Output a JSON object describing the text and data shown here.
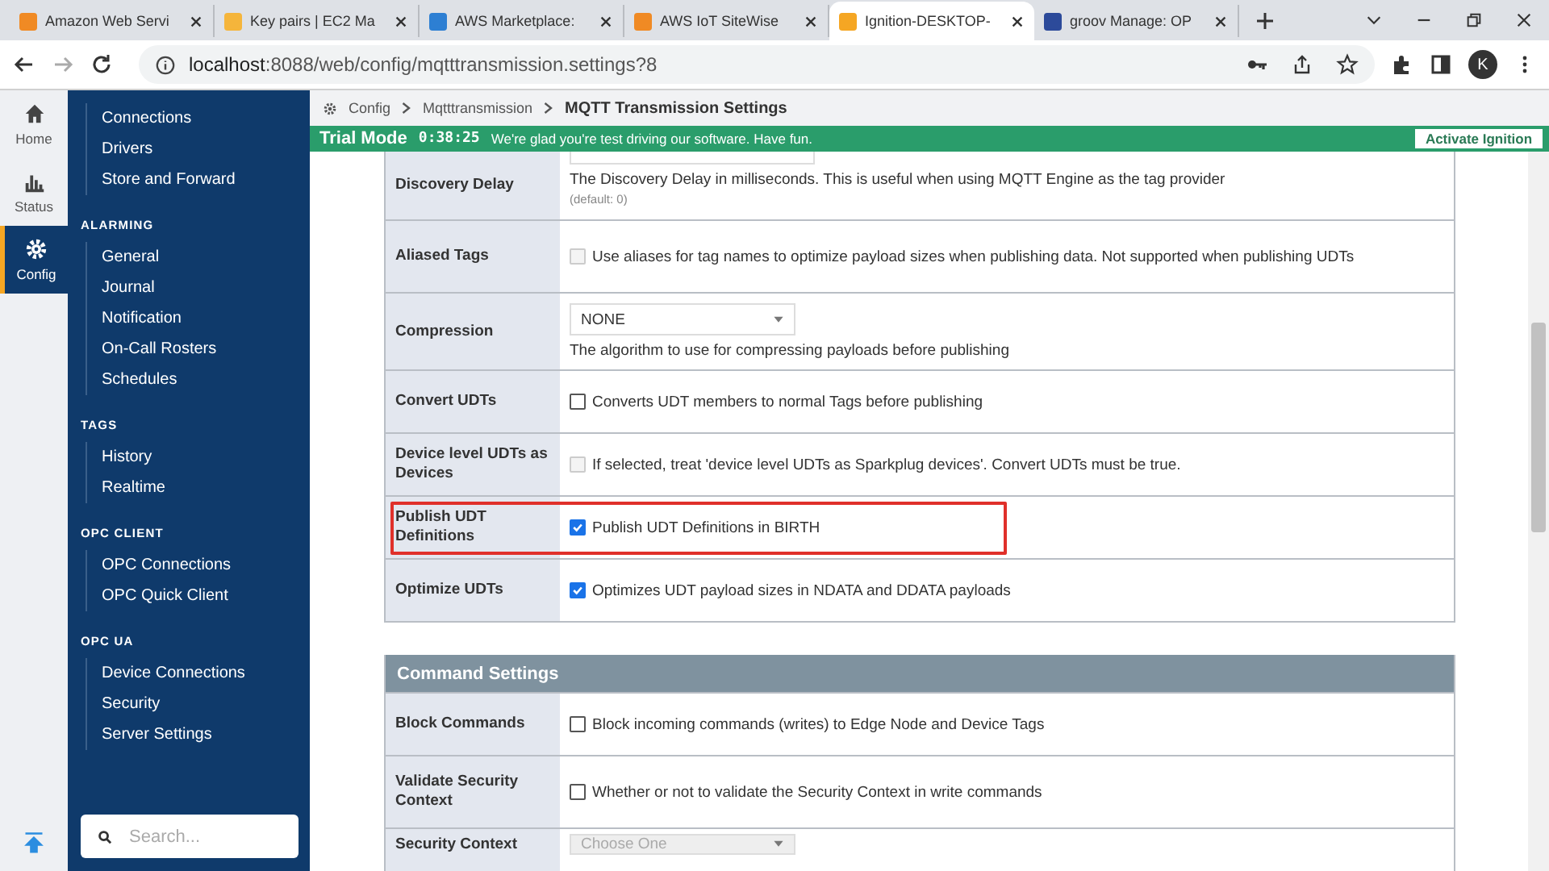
{
  "browser": {
    "tabs": [
      {
        "title": "Amazon Web Servi",
        "selected": false,
        "color": "#f08a24"
      },
      {
        "title": "Key pairs | EC2 Ma",
        "selected": false,
        "color": "#f5b53b"
      },
      {
        "title": "AWS Marketplace: ",
        "selected": false,
        "color": "#2d7fd3"
      },
      {
        "title": "AWS IoT SiteWise",
        "selected": false,
        "color": "#f08a24"
      },
      {
        "title": "Ignition-DESKTOP-",
        "selected": true,
        "color": "#f5a623"
      },
      {
        "title": "groov Manage: OP",
        "selected": false,
        "color": "#2c4a9a"
      }
    ],
    "url_host": "localhost",
    "url_rest": ":8088/web/config/mqtttransmission.settings?8",
    "profile": "K"
  },
  "rail": [
    {
      "label": "Home",
      "selected": false
    },
    {
      "label": "Status",
      "selected": false
    },
    {
      "label": "Config",
      "selected": true
    }
  ],
  "nav": [
    {
      "items": [
        "Connections",
        "Drivers",
        "Store and Forward"
      ]
    },
    {
      "heading": "ALARMING",
      "items": [
        "General",
        "Journal",
        "Notification",
        "On-Call Rosters",
        "Schedules"
      ]
    },
    {
      "heading": "TAGS",
      "items": [
        "History",
        "Realtime"
      ]
    },
    {
      "heading": "OPC CLIENT",
      "items": [
        "OPC Connections",
        "OPC Quick Client"
      ]
    },
    {
      "heading": "OPC UA",
      "items": [
        "Device Connections",
        "Security",
        "Server Settings"
      ]
    }
  ],
  "search": {
    "placeholder": "Search..."
  },
  "breadcrumb": [
    "Config",
    "Mqtttransmission",
    "MQTT Transmission Settings"
  ],
  "trial": {
    "label": "Trial Mode",
    "timer": "0:38:25",
    "message": "We're glad you're test driving our software. Have fun.",
    "button": "Activate Ignition"
  },
  "sections": [
    {
      "rows": [
        {
          "label": "Discovery Delay",
          "kind": "number",
          "description": "The Discovery Delay in milliseconds. This is useful when using MQTT Engine as the tag provider",
          "note": "(default: 0)",
          "highlighted": false
        },
        {
          "label": "Aliased Tags",
          "kind": "checkbox",
          "checked": false,
          "disabled": true,
          "description": "Use aliases for tag names to optimize payload sizes when publishing data. Not supported when publishing UDTs",
          "highlighted": false
        },
        {
          "label": "Compression",
          "kind": "select",
          "value": "NONE",
          "disabled": false,
          "description": "The algorithm to use for compressing payloads before publishing",
          "highlighted": false
        },
        {
          "label": "Convert UDTs",
          "kind": "checkbox",
          "checked": false,
          "disabled": false,
          "description": "Converts UDT members to normal Tags before publishing",
          "highlighted": false
        },
        {
          "label": "Device level UDTs as Devices",
          "kind": "checkbox",
          "checked": false,
          "disabled": true,
          "description": "If selected, treat 'device level UDTs as Sparkplug devices'. Convert UDTs must be true.",
          "highlighted": false
        },
        {
          "label": "Publish UDT Definitions",
          "kind": "checkbox",
          "checked": true,
          "disabled": false,
          "description": "Publish UDT Definitions in BIRTH",
          "highlighted": true
        },
        {
          "label": "Optimize UDTs",
          "kind": "checkbox",
          "checked": true,
          "disabled": false,
          "description": "Optimizes UDT payload sizes in NDATA and DDATA payloads",
          "highlighted": false
        }
      ]
    },
    {
      "heading": "Command Settings",
      "rows": [
        {
          "label": "Block Commands",
          "kind": "checkbox",
          "checked": false,
          "disabled": false,
          "description": "Block incoming commands (writes) to Edge Node and Device Tags",
          "highlighted": false
        },
        {
          "label": "Validate Security Context",
          "kind": "checkbox",
          "checked": false,
          "disabled": false,
          "description": "Whether or not to validate the Security Context in write commands",
          "highlighted": false
        },
        {
          "label": "Security Context",
          "kind": "select",
          "value": "Choose One",
          "disabled": true,
          "highlighted": false
        }
      ]
    }
  ]
}
